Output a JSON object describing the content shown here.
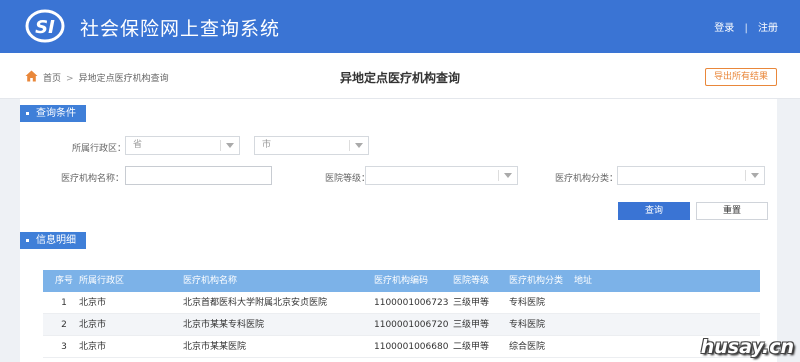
{
  "header": {
    "site_title": "社会保险网上查询系统",
    "login_label": "登录",
    "separator": "|",
    "register_label": "注册"
  },
  "breadcrumb": {
    "home_label": "首页",
    "arrow": ">",
    "current_label": "异地定点医疗机构查询"
  },
  "page_title": "异地定点医疗机构查询",
  "export_button_label": "导出所有结果",
  "query_section": {
    "tag_label": "查询条件",
    "region_label": "所属行政区：",
    "province_value": "省",
    "city_value": "市",
    "org_name_label": "医疗机构名称：",
    "org_name_value": "",
    "hospital_level_label": "医院等级：",
    "hospital_level_value": "",
    "org_type_label": "医疗机构分类：",
    "org_type_value": "",
    "query_button_label": "查询",
    "reset_button_label": "重置"
  },
  "info_section": {
    "tag_label": "信息明细",
    "columns": [
      "序号",
      "所属行政区",
      "医疗机构名称",
      "医疗机构编码",
      "医院等级",
      "医疗机构分类",
      "地址"
    ],
    "rows": [
      [
        "1",
        "北京市",
        "北京首都医科大学附属北京安贞医院",
        "1100001006723",
        "三级甲等",
        "专科医院",
        ""
      ],
      [
        "2",
        "北京市",
        "北京市某某专科医院",
        "1100001006720",
        "三级甲等",
        "专科医院",
        ""
      ],
      [
        "3",
        "北京市",
        "北京市某某医院",
        "1100001006680",
        "二级甲等",
        "综合医院",
        ""
      ]
    ]
  },
  "watermark": "husay.cn",
  "colors": {
    "header_blue": "#3a74d4",
    "table_header": "#7cb2e8",
    "export_orange": "#e9873a"
  },
  "icons": {
    "logo": "social-insurance-logo",
    "home": "home-icon",
    "dropdown": "chevron-down-icon"
  }
}
